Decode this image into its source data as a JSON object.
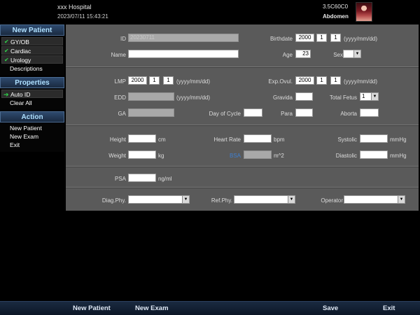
{
  "header": {
    "hospital": "xxx Hospital",
    "datetime": "2023/07/11 15:43:21",
    "probe": "3.5C60C0",
    "exam": "Abdomen",
    "exam_image_icon": "abdomen-preset-image"
  },
  "sidebar": {
    "new_patient_title": "New Patient",
    "exam_types": [
      {
        "label": "GY/OB",
        "checked": true
      },
      {
        "label": "Cardiac",
        "checked": true
      },
      {
        "label": "Urology",
        "checked": true
      }
    ],
    "descriptions_label": "Descriptions",
    "properties_title": "Properties",
    "auto_id_label": "Auto ID",
    "clear_all_label": "Clear All",
    "action_title": "Action",
    "actions": [
      "New Patient",
      "New Exam",
      "Exit"
    ]
  },
  "form": {
    "id_label": "ID",
    "id_value": "20230711",
    "birthdate_label": "Birthdate",
    "birth_year": "2000",
    "birth_month": "1",
    "birth_day": "1",
    "date_format": "(yyyy/mm/dd)",
    "name_label": "Name",
    "name_value": "",
    "age_label": "Age",
    "age_value": "23",
    "sex_label": "Sex",
    "sex_value": "",
    "lmp_label": "LMP",
    "lmp_year": "2000",
    "lmp_month": "1",
    "lmp_day": "1",
    "expovul_label": "Exp.Ovul.",
    "expovul_year": "2000",
    "expovul_month": "1",
    "expovul_day": "1",
    "edd_label": "EDD",
    "gravida_label": "Gravida",
    "total_fetus_label": "Total Fetus",
    "total_fetus_value": "1",
    "ga_label": "GA",
    "day_of_cycle_label": "Day of Cycle",
    "para_label": "Para",
    "aborta_label": "Aborta",
    "height_label": "Height",
    "height_unit": "cm",
    "heart_rate_label": "Heart Rate",
    "heart_rate_unit": "bpm",
    "systolic_label": "Systolic",
    "systolic_unit": "mmHg",
    "weight_label": "Weight",
    "weight_unit": "kg",
    "bsa_label": "BSA",
    "bsa_unit": "m^2",
    "diastolic_label": "Diastolic",
    "diastolic_unit": "mmHg",
    "psa_label": "PSA",
    "psa_unit": "ng/ml",
    "diag_phy_label": "Diag.Phy.",
    "ref_phy_label": "Ref.Phy.",
    "operator_label": "Operator"
  },
  "bottom": {
    "new_patient": "New Patient",
    "new_exam": "New Exam",
    "save": "Save",
    "exit": "Exit"
  },
  "colors": {
    "panel_bg": "#5a5a5a",
    "title_text": "#aee0ff",
    "check_green": "#2fd24a",
    "bsa_blue": "#3e7fd0"
  }
}
